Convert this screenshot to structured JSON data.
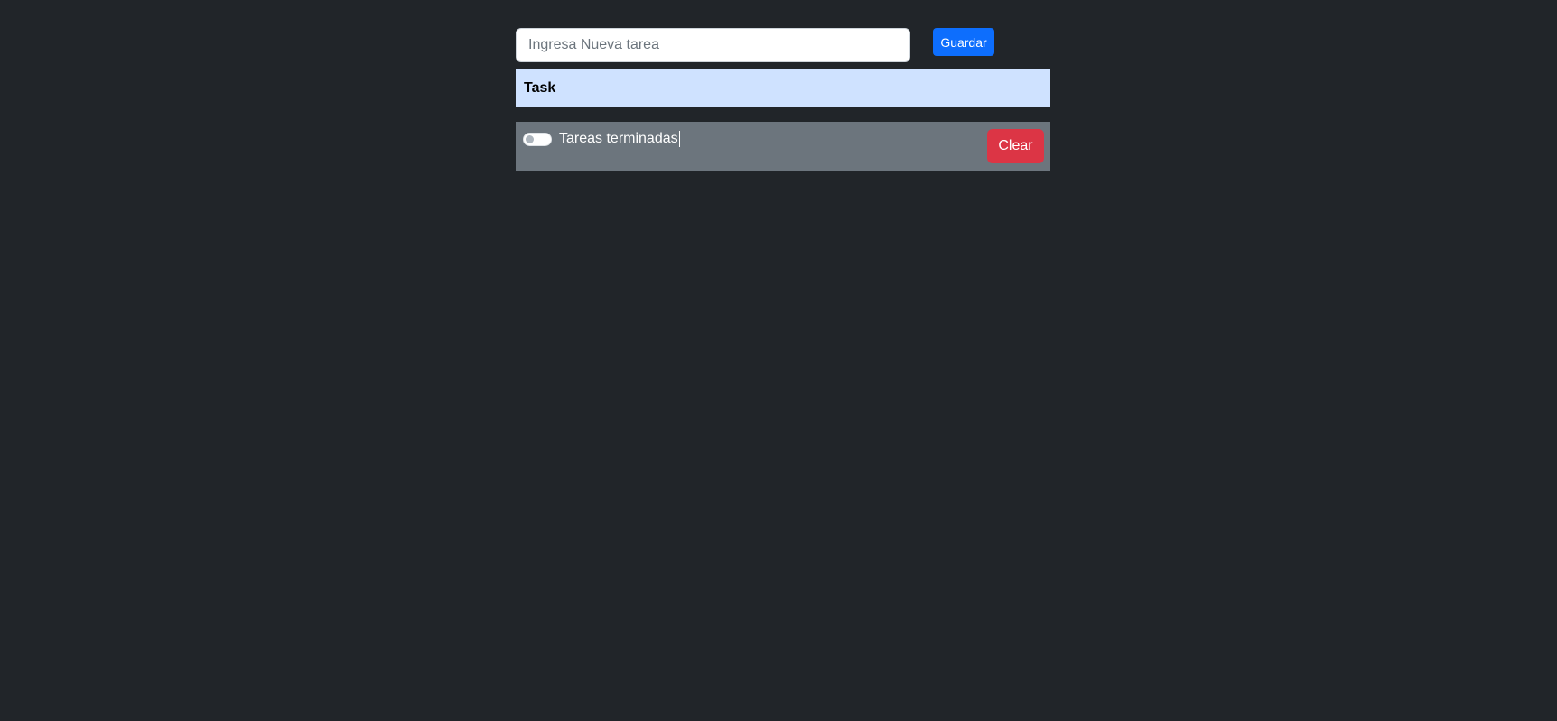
{
  "form": {
    "input_value": "",
    "input_placeholder": "Ingresa Nueva tarea",
    "save_label": "Guardar"
  },
  "list": {
    "header": "Task"
  },
  "footer": {
    "toggle_on": false,
    "toggle_label": "Tareas terminadas",
    "clear_label": "Clear"
  },
  "colors": {
    "background": "#212529",
    "primary": "#0d6efd",
    "danger": "#dc3545",
    "header_bg": "#cfe2ff",
    "footer_bg": "#6c757d"
  }
}
